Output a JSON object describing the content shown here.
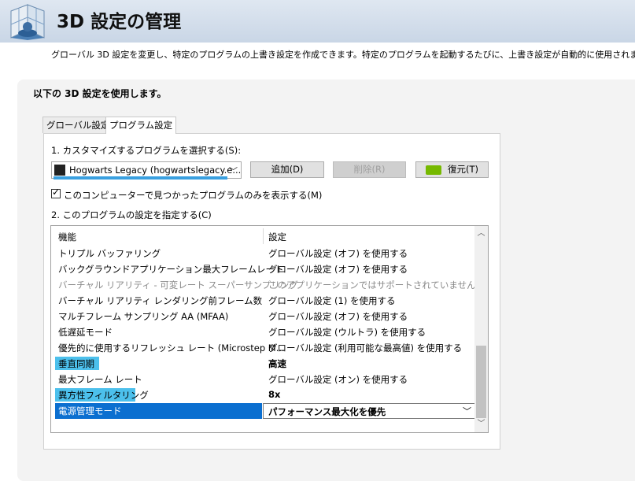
{
  "header": {
    "title": "3D 設定の管理",
    "description": "グローバル 3D 設定を変更し、特定のプログラムの上書き設定を作成できます。特定のプログラムを起動するたびに、上書き設定が自動的に使用されます。"
  },
  "section": {
    "label": "以下の 3D 設定を使用します。"
  },
  "tabs": [
    {
      "label": "グローバル設定",
      "active": false
    },
    {
      "label": "プログラム設定",
      "active": true
    }
  ],
  "program": {
    "step_label": "1. カスタマイズするプログラムを選択する(S):",
    "selected": "Hogwarts Legacy (hogwartslegacy.e...",
    "add_label": "追加(D)",
    "remove_label": "削除(R)",
    "restore_label": "復元(T)",
    "brand_color": "#76b900",
    "icon": "hogwarts-app-icon"
  },
  "checkbox": {
    "label": "このコンピューターで見つかったプログラムのみを表示する(M)",
    "checked": true
  },
  "settings": {
    "step_label": "2. このプログラムの設定を指定する(C)",
    "col_feature": "機能",
    "col_setting": "設定",
    "rows": [
      {
        "feature": "トリプル バッファリング",
        "setting": "グローバル設定 (オフ) を使用する"
      },
      {
        "feature": "バックグラウンドアプリケーション最大フレームレート",
        "setting": "グローバル設定 (オフ) を使用する"
      },
      {
        "feature": "バーチャル リアリティ - 可変レート スーパーサンプリング",
        "setting": "このアプリケーションではサポートされていません"
      },
      {
        "feature": "バーチャル リアリティ レンダリング前フレーム数",
        "setting": "グローバル設定 (1) を使用する"
      },
      {
        "feature": "マルチフレーム サンプリング AA (MFAA)",
        "setting": "グローバル設定 (オフ) を使用する"
      },
      {
        "feature": "低遅延モード",
        "setting": "グローバル設定 (ウルトラ) を使用する"
      },
      {
        "feature": "優先的に使用するリフレッシュ レート (Microstep M...",
        "setting": "グローバル設定 (利用可能な最高値) を使用する"
      },
      {
        "feature": "垂直同期",
        "setting": "高速"
      },
      {
        "feature": "最大フレーム レート",
        "setting": "グローバル設定 (オン) を使用する"
      },
      {
        "feature": "異方性フィルタリング",
        "setting": "8x"
      },
      {
        "feature": "電源管理モード",
        "setting": "パフォーマンス最大化を優先"
      }
    ],
    "highlight_color": "#4cc0ec",
    "selection_color": "#0b6fd0"
  }
}
